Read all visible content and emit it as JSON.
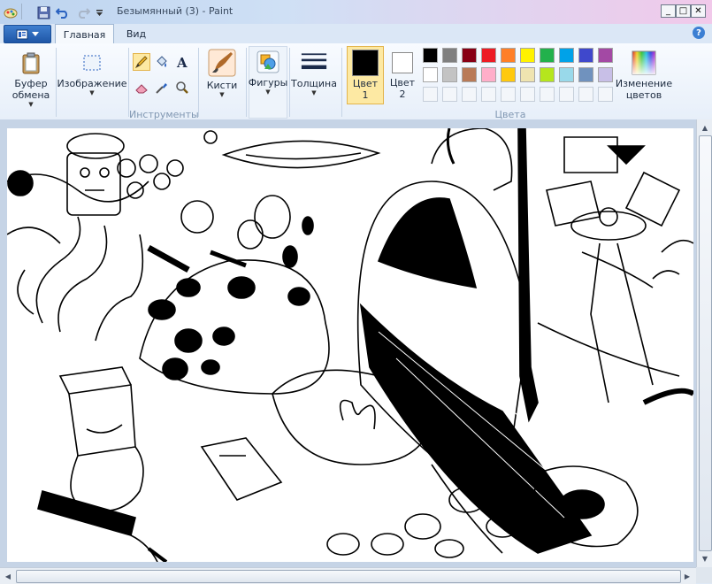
{
  "window": {
    "title": "Безымянный (3) - Paint",
    "controls": [
      "_",
      "□",
      "✕"
    ]
  },
  "quick_access": [
    "app-icon",
    "save-icon",
    "undo-icon",
    "redo-icon",
    "customize-icon"
  ],
  "ribbon": {
    "app_menu_icon": "menu-icon",
    "tabs": [
      "Главная",
      "Вид"
    ],
    "active_tab": "Главная",
    "groups": {
      "clipboard": {
        "label": "Буфер обмена",
        "line1": "Буфер",
        "line2": "обмена"
      },
      "image": {
        "label": "Изображение"
      },
      "tools": {
        "label": "Инструменты"
      },
      "brushes": {
        "label": "Кисти"
      },
      "shapes": {
        "label": "Фигуры"
      },
      "thickness": {
        "label": "Толщина"
      },
      "color1": {
        "line1": "Цвет",
        "line2": "1",
        "value": "#000000"
      },
      "color2": {
        "line1": "Цвет",
        "line2": "2",
        "value": "#ffffff"
      },
      "colors": {
        "label": "Цвета"
      },
      "edit_colors": {
        "line1": "Изменение",
        "line2": "цветов"
      }
    },
    "palette_row1": [
      "#000000",
      "#7f7f7f",
      "#880015",
      "#ed1c24",
      "#ff7f27",
      "#fff200",
      "#22b14c",
      "#00a2e8",
      "#3f48cc",
      "#a349a4"
    ],
    "palette_row2": [
      "#ffffff",
      "#c3c3c3",
      "#b97a57",
      "#ffaec9",
      "#ffc90e",
      "#efe4b0",
      "#b5e61d",
      "#99d9ea",
      "#7092be",
      "#c8bfe7"
    ]
  },
  "help_label": "?"
}
